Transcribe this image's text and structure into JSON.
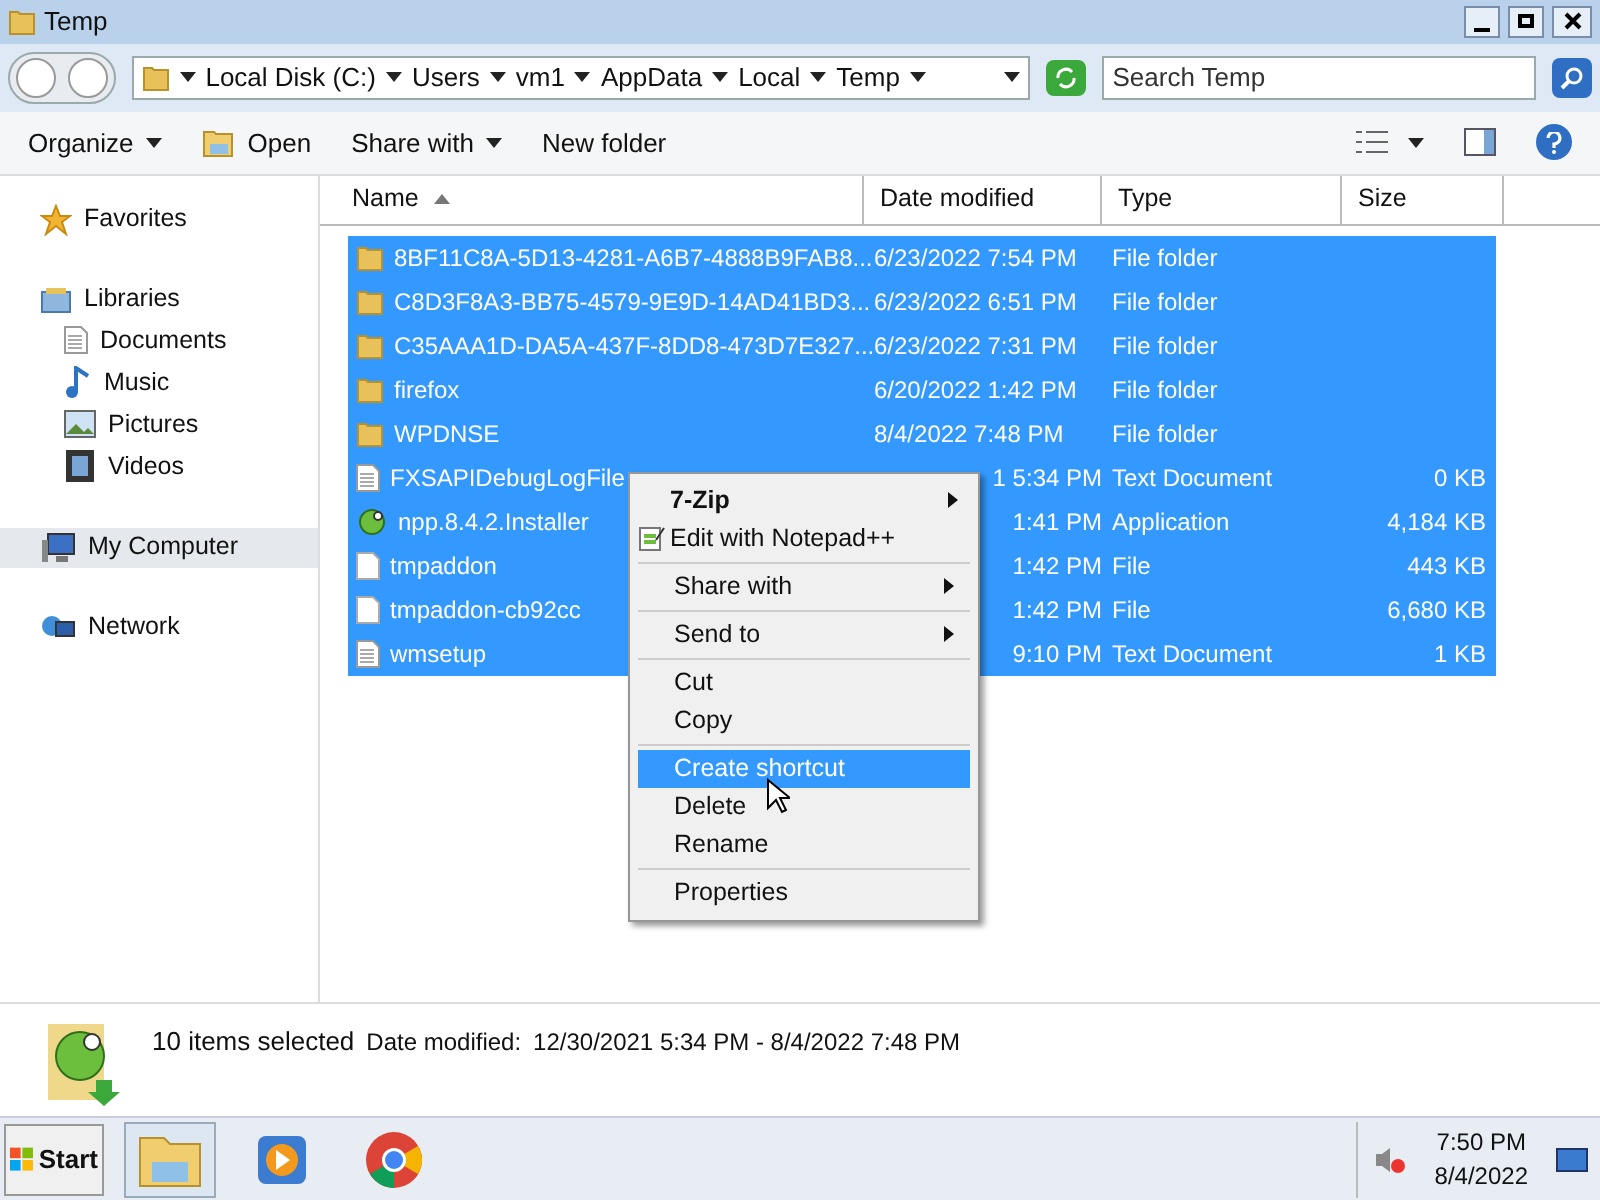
{
  "window": {
    "title": "Temp"
  },
  "address": {
    "crumbs": [
      "Local Disk (C:)",
      "Users",
      "vm1",
      "AppData",
      "Local",
      "Temp"
    ]
  },
  "search": {
    "placeholder": "Search Temp"
  },
  "toolbar": [
    {
      "label": "Organize",
      "kind": "menu"
    },
    {
      "label": "Open",
      "kind": "icon"
    },
    {
      "label": "Share with",
      "kind": "menu"
    },
    {
      "label": "New folder",
      "kind": "plain"
    }
  ],
  "sidebar": {
    "items": [
      {
        "label": "Favorites",
        "kind": "star",
        "selected": false
      },
      {
        "label": "Libraries",
        "kind": "library",
        "selected": false,
        "children": [
          {
            "label": "Documents",
            "kind": "doc"
          },
          {
            "label": "Music",
            "kind": "music"
          },
          {
            "label": "Pictures",
            "kind": "pictures"
          },
          {
            "label": "Videos",
            "kind": "videos"
          }
        ]
      },
      {
        "label": "My Computer",
        "kind": "computer",
        "selected": true
      },
      {
        "label": "Network",
        "kind": "network",
        "selected": false
      }
    ]
  },
  "table": {
    "columns": [
      "Name",
      "Date modified",
      "Type",
      "Size"
    ],
    "rows": [
      {
        "name": "8BF11C8A-5D13-4281-A6B7-4888B9FAB8...",
        "date": "6/23/2022 7:54 PM",
        "type": "File folder",
        "size": "",
        "kind": "folder",
        "selected": true,
        "covered": false
      },
      {
        "name": "C8D3F8A3-BB75-4579-9E9D-14AD41BD3...",
        "date": "6/23/2022 6:51 PM",
        "type": "File folder",
        "size": "",
        "kind": "folder",
        "selected": true,
        "covered": false
      },
      {
        "name": "C35AAA1D-DA5A-437F-8DD8-473D7E327...",
        "date": "6/23/2022 7:31 PM",
        "type": "File folder",
        "size": "",
        "kind": "folder",
        "selected": true,
        "covered": false
      },
      {
        "name": "firefox",
        "date": "6/20/2022 1:42 PM",
        "type": "File folder",
        "size": "",
        "kind": "folder",
        "selected": true,
        "covered": false
      },
      {
        "name": "WPDNSE",
        "date": "8/4/2022 7:48 PM",
        "type": "File folder",
        "size": "",
        "kind": "folder",
        "selected": true,
        "covered": false
      },
      {
        "name": "FXSAPIDebugLogFile",
        "date": "1 5:34 PM",
        "type": "Text Document",
        "size": "0 KB",
        "kind": "text",
        "selected": true,
        "covered": true
      },
      {
        "name": "npp.8.4.2.Installer",
        "date": "1:41 PM",
        "type": "Application",
        "size": "4,184 KB",
        "kind": "app",
        "selected": true,
        "covered": true
      },
      {
        "name": "tmpaddon",
        "date": "1:42 PM",
        "type": "File",
        "size": "443 KB",
        "kind": "file",
        "selected": true,
        "covered": true
      },
      {
        "name": "tmpaddon-cb92cc",
        "date": "1:42 PM",
        "type": "File",
        "size": "6,680 KB",
        "kind": "file",
        "selected": true,
        "covered": true
      },
      {
        "name": "wmsetup",
        "date": "9:10 PM",
        "type": "Text Document",
        "size": "1 KB",
        "kind": "text",
        "selected": true,
        "covered": true
      }
    ]
  },
  "context_menu": {
    "groups": [
      [
        {
          "label": "7-Zip",
          "bold": true,
          "submenu": true,
          "icon": false,
          "selected": false
        },
        {
          "label": "Edit with Notepad++",
          "bold": false,
          "submenu": false,
          "icon": true,
          "selected": false
        }
      ],
      [
        {
          "label": "Share with",
          "bold": false,
          "submenu": true,
          "icon": false,
          "selected": false
        }
      ],
      [
        {
          "label": "Send to",
          "bold": false,
          "submenu": true,
          "icon": false,
          "selected": false
        }
      ],
      [
        {
          "label": "Cut",
          "bold": false,
          "submenu": false,
          "icon": false,
          "selected": false
        },
        {
          "label": "Copy",
          "bold": false,
          "submenu": false,
          "icon": false,
          "selected": false
        }
      ],
      [
        {
          "label": "Create shortcut",
          "bold": false,
          "submenu": false,
          "icon": false,
          "selected": true
        },
        {
          "label": "Delete",
          "bold": false,
          "submenu": false,
          "icon": false,
          "selected": false
        },
        {
          "label": "Rename",
          "bold": false,
          "submenu": false,
          "icon": false,
          "selected": false
        }
      ],
      [
        {
          "label": "Properties",
          "bold": false,
          "submenu": false,
          "icon": false,
          "selected": false
        }
      ]
    ]
  },
  "details": {
    "count": "10 items selected",
    "date_label": "Date modified:",
    "date_range": "12/30/2021 5:34 PM - 8/4/2022 7:48 PM"
  },
  "taskbar": {
    "start": "Start",
    "apps": [
      {
        "kind": "explorer",
        "selected": true
      },
      {
        "kind": "media",
        "selected": false
      },
      {
        "kind": "chrome",
        "selected": false
      }
    ],
    "time": "7:50 PM",
    "date": "8/4/2022"
  }
}
